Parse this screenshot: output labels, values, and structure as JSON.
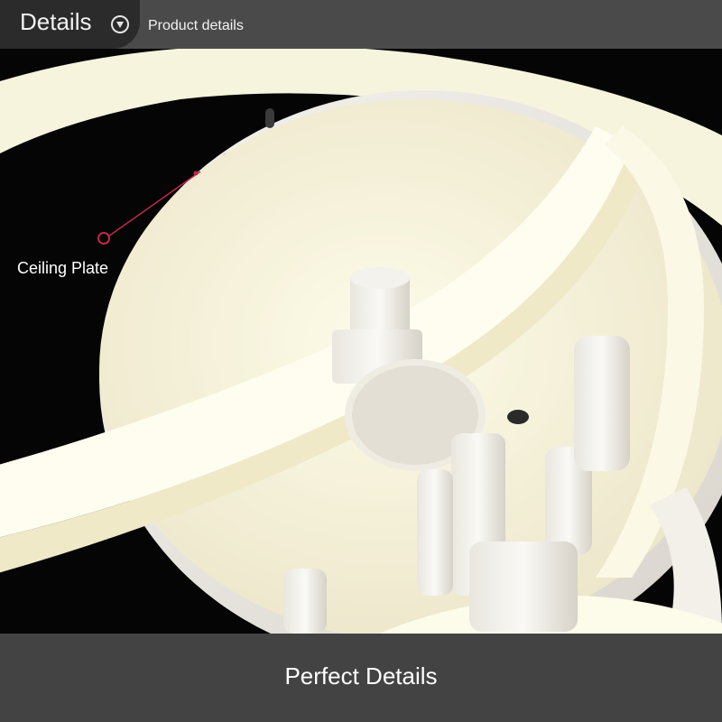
{
  "header": {
    "title": "Details",
    "icon": "chevron-down-circle-icon",
    "subtitle": "Product details"
  },
  "photo": {
    "callout_label": "Ceiling Plate",
    "callout_color": "#c2284a"
  },
  "footer": {
    "caption": "Perfect Details"
  }
}
